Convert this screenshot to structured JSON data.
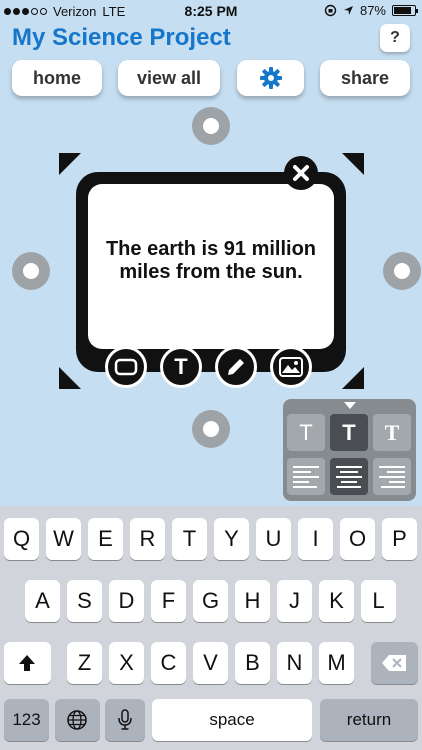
{
  "status_bar": {
    "carrier": "Verizon",
    "network": "LTE",
    "time": "8:25 PM",
    "battery": "87%",
    "battery_level": 0.87
  },
  "header": {
    "title": "My Science Project",
    "help_label": "?"
  },
  "toolbar": {
    "home_label": "home",
    "view_all_label": "view all",
    "settings_icon": "gear-icon",
    "share_label": "share"
  },
  "text_box": {
    "text": "The earth is 91 million miles from the sun.",
    "close_icon": "close-icon",
    "mode_buttons": [
      "frame-icon",
      "text-icon",
      "pencil-icon",
      "image-icon"
    ],
    "mode_text_label": "T"
  },
  "format_panel": {
    "font_options": [
      "T",
      "T",
      "T"
    ],
    "selected_font": 1,
    "alignments": [
      "left",
      "center",
      "right"
    ],
    "selected_alignment": 1
  },
  "keyboard": {
    "row1": [
      "Q",
      "W",
      "E",
      "R",
      "T",
      "Y",
      "U",
      "I",
      "O",
      "P"
    ],
    "row2": [
      "A",
      "S",
      "D",
      "F",
      "G",
      "H",
      "J",
      "K",
      "L"
    ],
    "row3": [
      "Z",
      "X",
      "C",
      "V",
      "B",
      "N",
      "M"
    ],
    "numbers_label": "123",
    "space_label": "space",
    "return_label": "return",
    "colors": {
      "accent": "#1676c9",
      "background": "#c5def1",
      "panel": "#868b90"
    }
  }
}
